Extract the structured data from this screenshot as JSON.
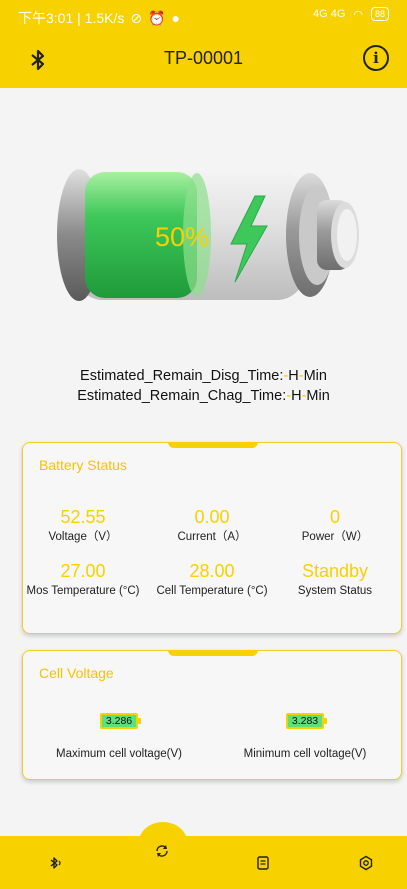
{
  "status_bar": {
    "time_speed": "下午3:01 | 1.5K/s",
    "signal": "4G 4G",
    "battery": "88"
  },
  "app_bar": {
    "title": "TP-00001"
  },
  "battery_graphic": {
    "percent_text": "50%",
    "charge_level": 0.5
  },
  "estimates": {
    "disg_label": "Estimated_Remain_Disg_Time:",
    "chag_label": "Estimated_Remain_Chag_Time:",
    "h": "H",
    "min": "Min"
  },
  "battery_status": {
    "title": "Battery Status",
    "items": [
      {
        "value": "52.55",
        "label": "Voltage（V）"
      },
      {
        "value": "0.00",
        "label": "Current（A）"
      },
      {
        "value": "0",
        "label": "Power（W）"
      },
      {
        "value": "27.00",
        "label": "Mos Temperature (°C)"
      },
      {
        "value": "28.00",
        "label": "Cell Temperature (°C)"
      },
      {
        "value": "Standby",
        "label": "System Status"
      }
    ]
  },
  "cell_voltage": {
    "title": "Cell Voltage",
    "max_value": "3.286",
    "max_label": "Maximum cell voltage(V)",
    "min_value": "3.283",
    "min_label": "Minimum cell voltage(V)"
  },
  "colors": {
    "accent": "#f8d100",
    "charge": "#3ec85a"
  }
}
